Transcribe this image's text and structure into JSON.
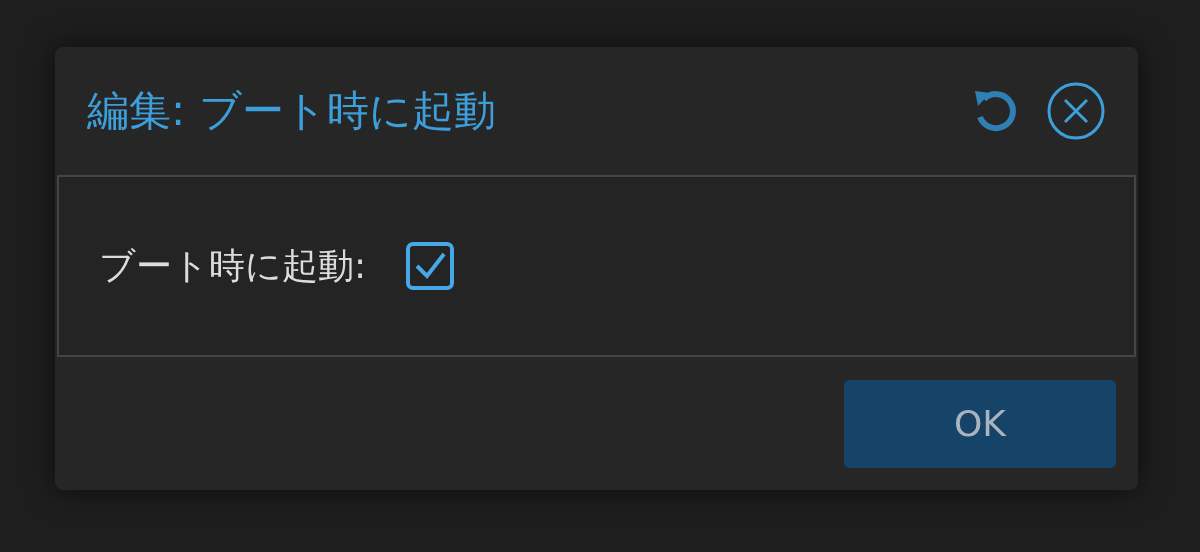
{
  "dialog": {
    "title": "編集: ブート時に起動"
  },
  "fields": [
    {
      "label": "ブート時に起動:",
      "kind": "checkbox",
      "checked": true
    }
  ],
  "buttons": [
    {
      "label": "OK"
    }
  ]
}
